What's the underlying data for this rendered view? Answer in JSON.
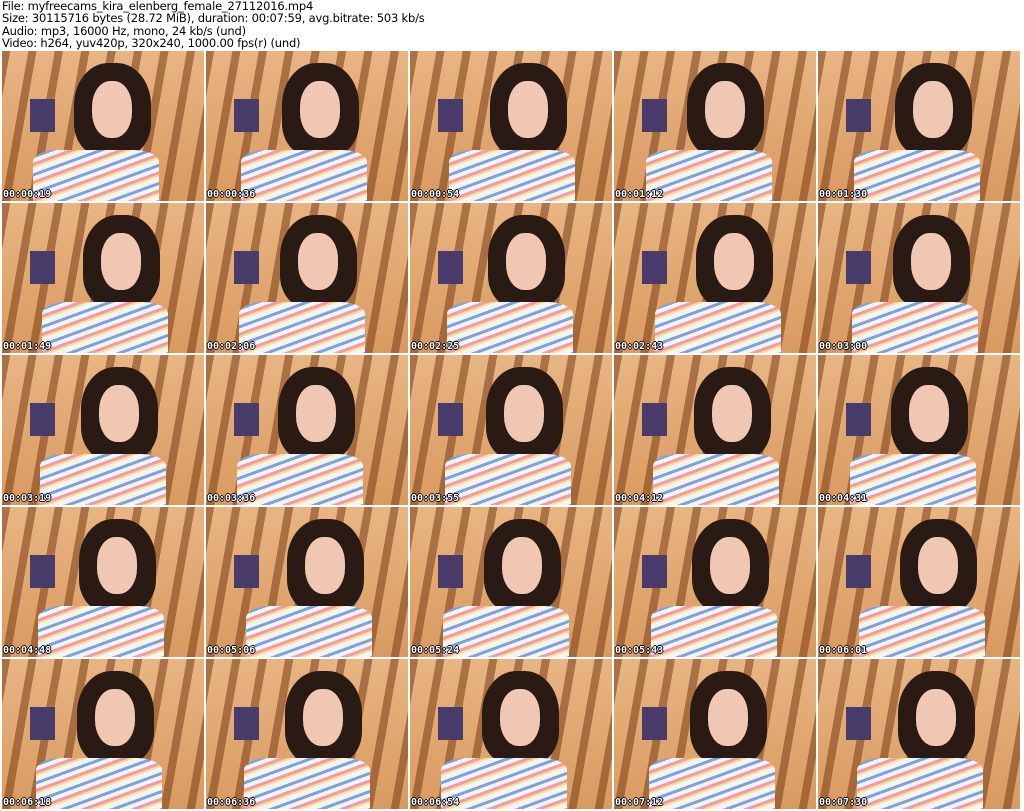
{
  "header": {
    "file": "File: myfreecams_kira_elenberg_female_27112016.mp4",
    "size": "Size: 30115716 bytes (28.72 MiB), duration: 00:07:59, avg.bitrate: 503 kb/s",
    "audio": "Audio: mp3, 16000 Hz, mono, 24 kb/s (und)",
    "video": "Video: h264, yuv420p, 320x240, 1000.00 fps(r) (und)"
  },
  "thumbnails": [
    "00:00:19",
    "00:00:36",
    "00:00:54",
    "00:01:12",
    "00:01:30",
    "00:01:49",
    "00:02:06",
    "00:02:25",
    "00:02:43",
    "00:03:00",
    "00:03:19",
    "00:03:36",
    "00:03:55",
    "00:04:12",
    "00:04:31",
    "00:04:48",
    "00:05:06",
    "00:05:24",
    "00:05:43",
    "00:06:01",
    "00:06:18",
    "00:06:36",
    "00:06:54",
    "00:07:12",
    "00:07:30"
  ]
}
